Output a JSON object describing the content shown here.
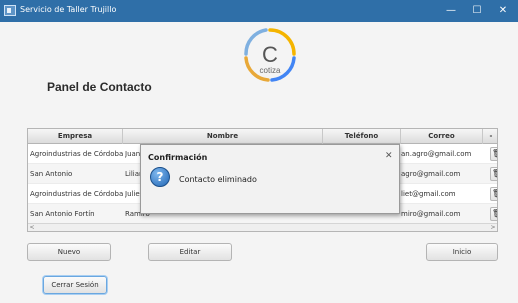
{
  "window": {
    "title": "Servicio de Taller Trujillo",
    "minimize_glyph": "—",
    "maximize_glyph": "☐",
    "close_glyph": "✕"
  },
  "page": {
    "heading": "Panel de Contacto"
  },
  "logo": {
    "letter": "C",
    "text": "cotiza",
    "colors": [
      "#f4b400",
      "#4285f4",
      "#e8a838",
      "#7fb0e0"
    ]
  },
  "table": {
    "columns": [
      "Empresa",
      "Nombre",
      "Teléfono",
      "Correo",
      "-"
    ],
    "rows": [
      {
        "empresa": "Agroindustrias de Córdoba",
        "nombre": "Juan",
        "telefono": "",
        "correo": "an.agro@gmail.com"
      },
      {
        "empresa": "San Antonio",
        "nombre": "Lilian",
        "telefono": "",
        "correo": "agro@gmail.com"
      },
      {
        "empresa": "Agroindustrias de Córdoba",
        "nombre": "Julieta",
        "telefono": "",
        "correo": "liet@gmail.com"
      },
      {
        "empresa": "San Antonio Fortín",
        "nombre": "Ramiro",
        "telefono": "",
        "correo": "miro@gmail.com"
      }
    ],
    "delete_glyph": "🗑",
    "scroll_left": "<",
    "scroll_right": ">"
  },
  "dialog": {
    "title": "Confirmación",
    "message": "Contacto eliminado",
    "icon_glyph": "?",
    "close_glyph": "✕"
  },
  "buttons": {
    "nuevo": "Nuevo",
    "editar": "Editar",
    "inicio": "Inicio",
    "cerrar_sesion": "Cerrar Sesión"
  },
  "colors": {
    "titlebar": "#2f6fa8",
    "dialog_icon": "#2166b5"
  }
}
